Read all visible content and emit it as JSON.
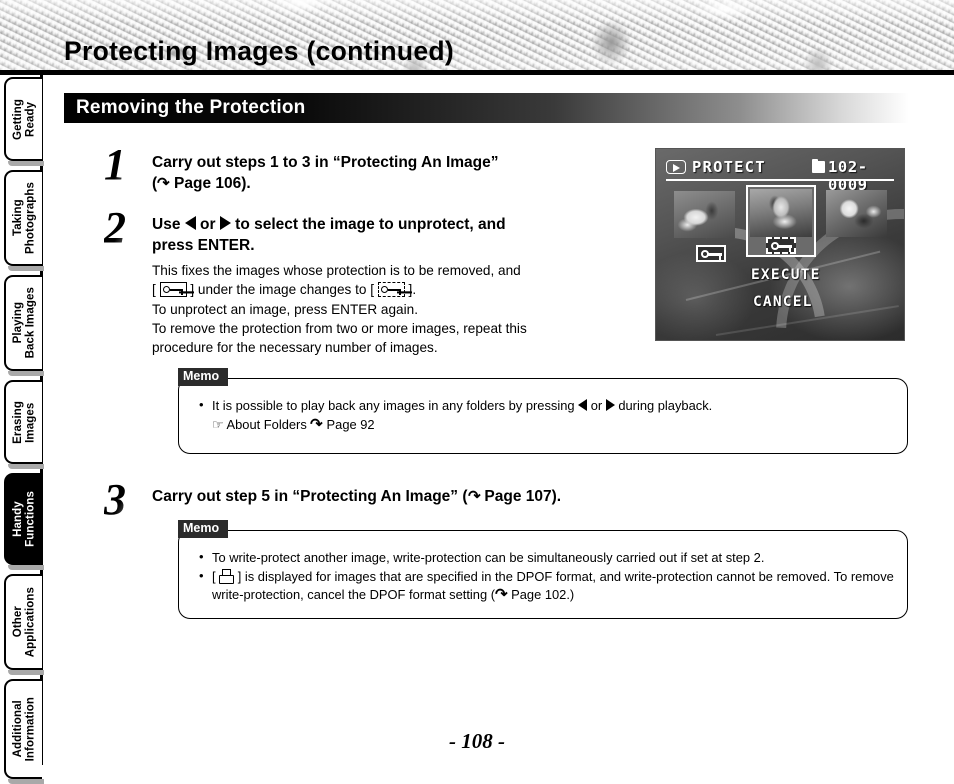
{
  "header": {
    "title": "Protecting Images (continued)"
  },
  "section": {
    "title": "Removing the Protection"
  },
  "sidebar": {
    "items": [
      {
        "label": "Getting\nReady",
        "active": false
      },
      {
        "label": "Taking\nPhotographs",
        "active": false
      },
      {
        "label": "Playing\nBack Images",
        "active": false
      },
      {
        "label": "Erasing\nImages",
        "active": false
      },
      {
        "label": "Handy\nFunctions",
        "active": true
      },
      {
        "label": "Other\nApplications",
        "active": false
      },
      {
        "label": "Additional\nInformation",
        "active": false
      }
    ]
  },
  "steps": [
    {
      "number": "1",
      "heading_line1": "Carry out steps 1 to 3 in “Protecting An Image”",
      "heading_line2_prefix": "(",
      "heading_line2_suffix": " Page 106)."
    },
    {
      "number": "2",
      "heading_prefix": "Use ",
      "heading_mid": " or ",
      "heading_suffix": " to select the image to unprotect, and",
      "heading_line2": "press ENTER.",
      "body_line1": "This fixes the images whose protection is to be removed, and",
      "body_line2_a": "[ ",
      "body_line2_b": " ] under the image changes to [ ",
      "body_line2_c": " ].",
      "body_line3": "To unprotect an image, press ENTER again.",
      "body_line4": "To remove the protection from two or more images, repeat this",
      "body_line5": "procedure for the necessary number of images."
    },
    {
      "number": "3",
      "heading_a": "Carry out step 5 in “Protecting An Image” (",
      "heading_b": " Page 107)."
    }
  ],
  "memo1": {
    "label": "Memo",
    "bullet1_a": "It is possible to play back any images in any folders by pressing ",
    "bullet1_b": " or ",
    "bullet1_c": " during playback.",
    "sub1_hand": "☞",
    "sub1_text": "About Folders",
    "sub1_page": " Page 92"
  },
  "memo2": {
    "label": "Memo",
    "bullet1": "To write-protect another image, write-protection can be simultaneously carried out if set at step 2.",
    "bullet2_a": "[ ",
    "bullet2_b": " ] is displayed for images that are specified in the DPOF format, and write-protection cannot be",
    "bullet2_c": "removed. To remove write-protection, cancel the DPOF format setting (",
    "bullet2_d": " Page 102.)"
  },
  "lcd": {
    "mode_label": "PROTECT",
    "file_number": "102-0009",
    "execute_label": "EXECUTE",
    "cancel_label": "CANCEL"
  },
  "footer": {
    "page_number": "- 108 -"
  },
  "icons": {
    "page_arrow": "↶"
  }
}
